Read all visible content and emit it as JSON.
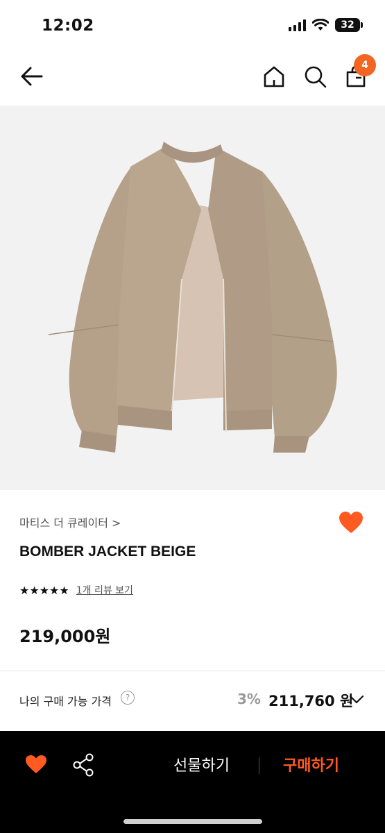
{
  "status_bar": {
    "time": "12:02",
    "battery": "32"
  },
  "nav": {
    "cart_count": "4"
  },
  "product": {
    "brand": "마티스 더 큐레이터 >",
    "name": "BOMBER JACKET BEIGE",
    "rating": 5,
    "stars": "★★★★★",
    "review_link": "1개 리뷰 보기",
    "price": "219,000원"
  },
  "my_price": {
    "label": "나의 구매 가능 가격",
    "help": "?",
    "discount_rate": "3%",
    "discount_price": "211,760 원"
  },
  "bottom_bar": {
    "gift_label": "선물하기",
    "buy_label": "구매하기"
  },
  "colors": {
    "accent": "#ff5a1f",
    "badge": "#f26522",
    "jacket": "#b5a089",
    "image_bg": "#f2f2f2"
  }
}
